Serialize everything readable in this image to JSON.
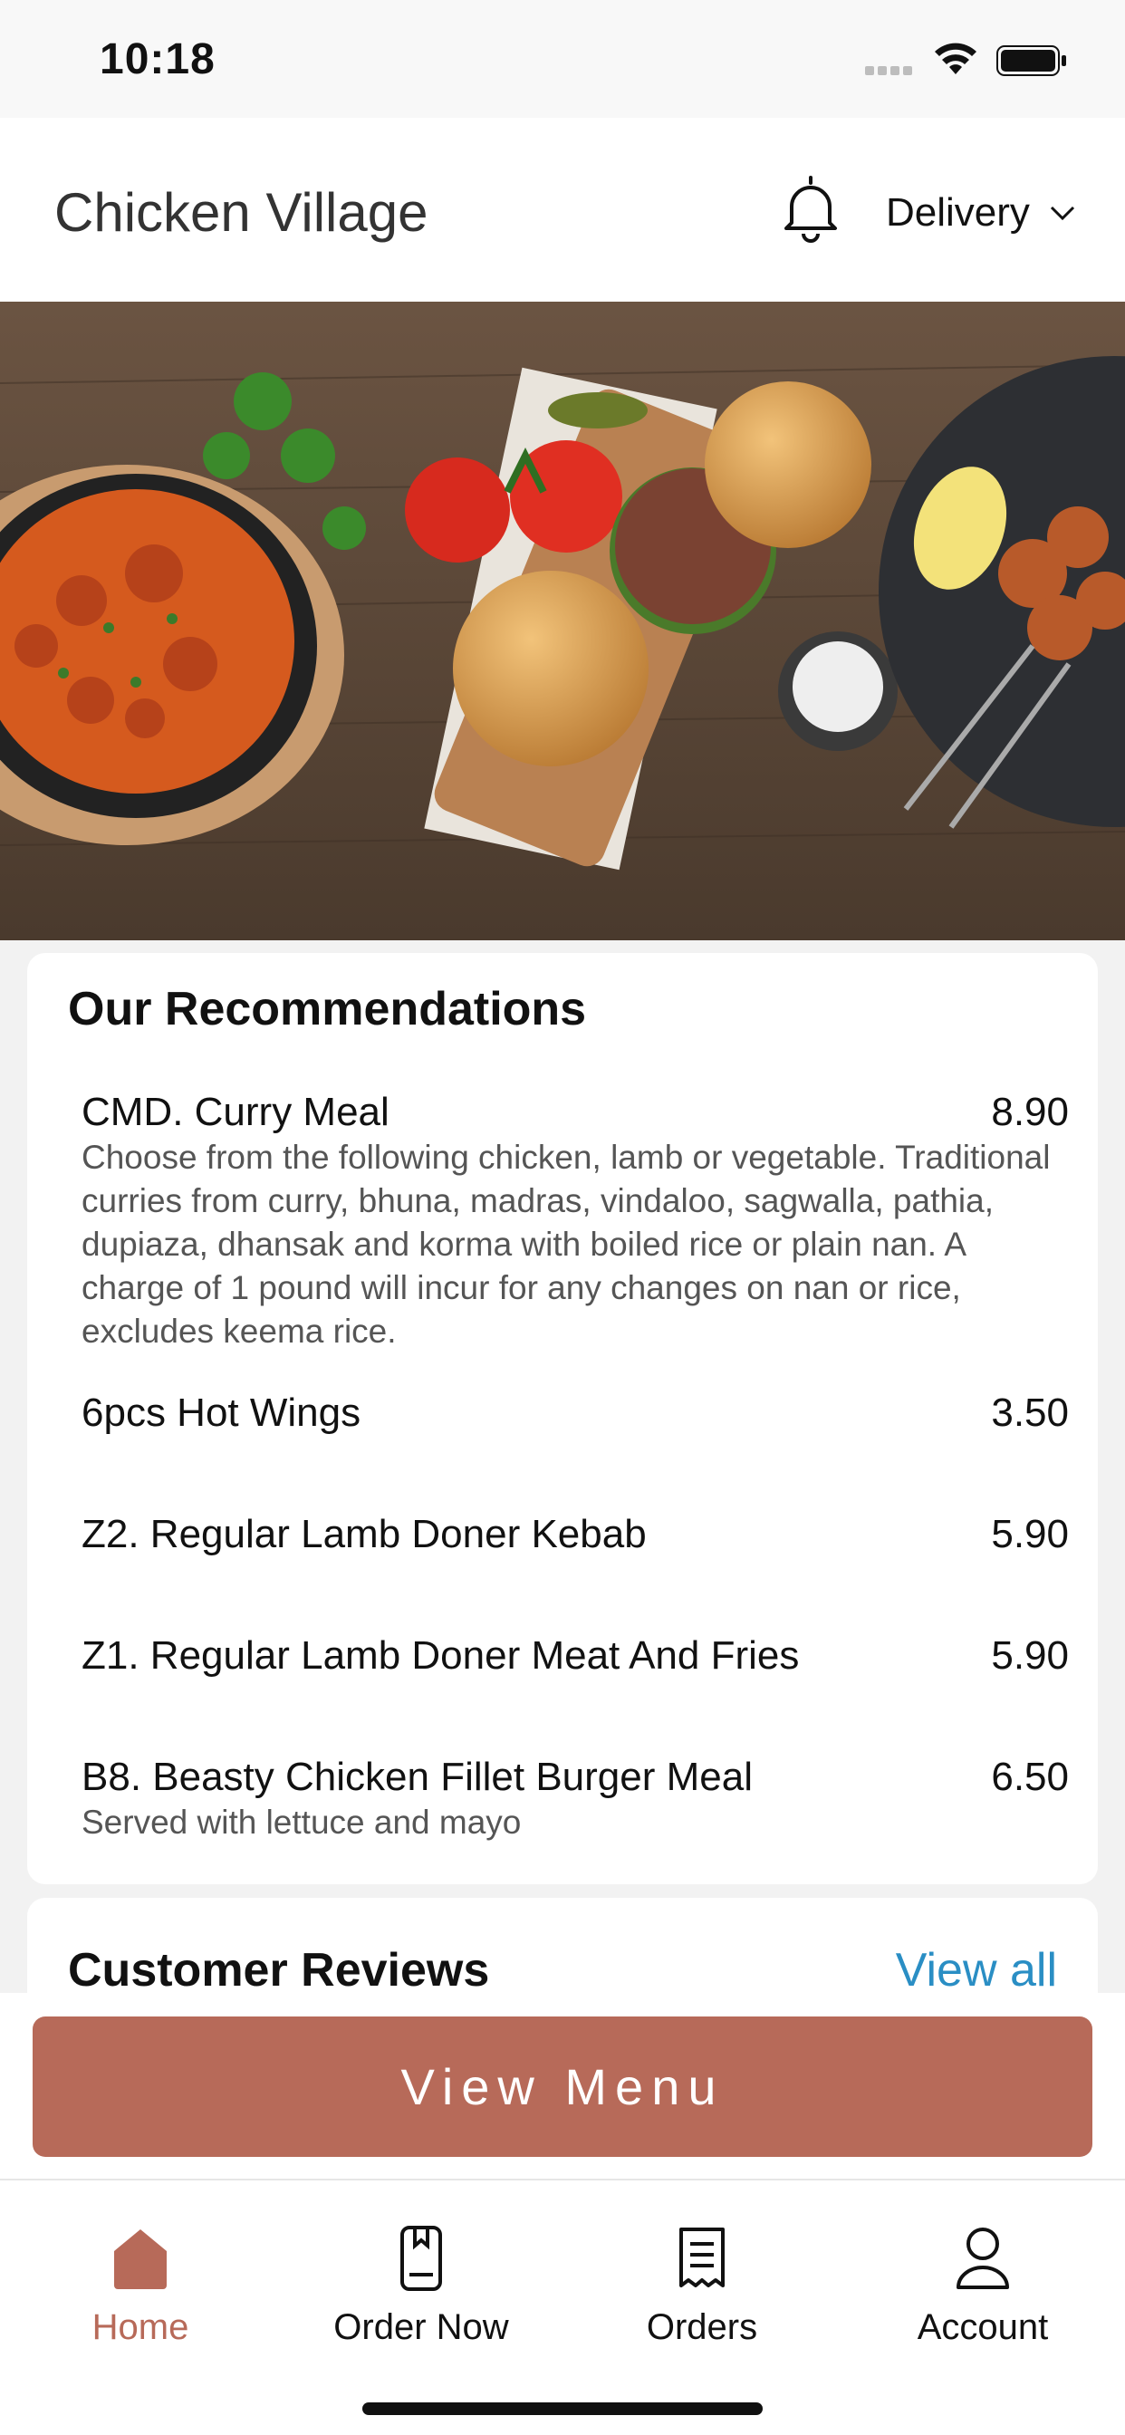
{
  "status_bar": {
    "time": "10:18"
  },
  "header": {
    "title": "Chicken Village",
    "delivery_label": "Delivery"
  },
  "hero": {
    "alt": "Food spread with curry, burgers and skewers"
  },
  "recommendations": {
    "heading": "Our Recommendations",
    "items": [
      {
        "name": "CMD. Curry Meal",
        "price": "8.90",
        "description": "Choose from the following chicken, lamb or vegetable. Traditional curries from curry, bhuna, madras, vindaloo, sagwalla, pathia, dupiaza, dhansak and korma with boiled rice or plain nan. A charge of 1 pound will incur for any changes on nan or rice, excludes keema rice."
      },
      {
        "name": "6pcs Hot Wings",
        "price": "3.50",
        "description": ""
      },
      {
        "name": "Z2. Regular Lamb Doner Kebab",
        "price": "5.90",
        "description": ""
      },
      {
        "name": "Z1. Regular Lamb Doner Meat And Fries",
        "price": "5.90",
        "description": ""
      },
      {
        "name": "B8. Beasty Chicken Fillet Burger Meal",
        "price": "6.50",
        "description": "Served with lettuce and mayo"
      }
    ]
  },
  "reviews": {
    "heading": "Customer Reviews",
    "view_all": "View all"
  },
  "actions": {
    "view_menu": "View Menu"
  },
  "tabbar": {
    "items": [
      {
        "label": "Home",
        "icon": "home-icon",
        "active": true
      },
      {
        "label": "Order Now",
        "icon": "order-book-icon",
        "active": false
      },
      {
        "label": "Orders",
        "icon": "receipt-icon",
        "active": false
      },
      {
        "label": "Account",
        "icon": "user-icon",
        "active": false
      }
    ]
  },
  "colors": {
    "accent": "#b76a59",
    "link": "#2a8ec4"
  }
}
